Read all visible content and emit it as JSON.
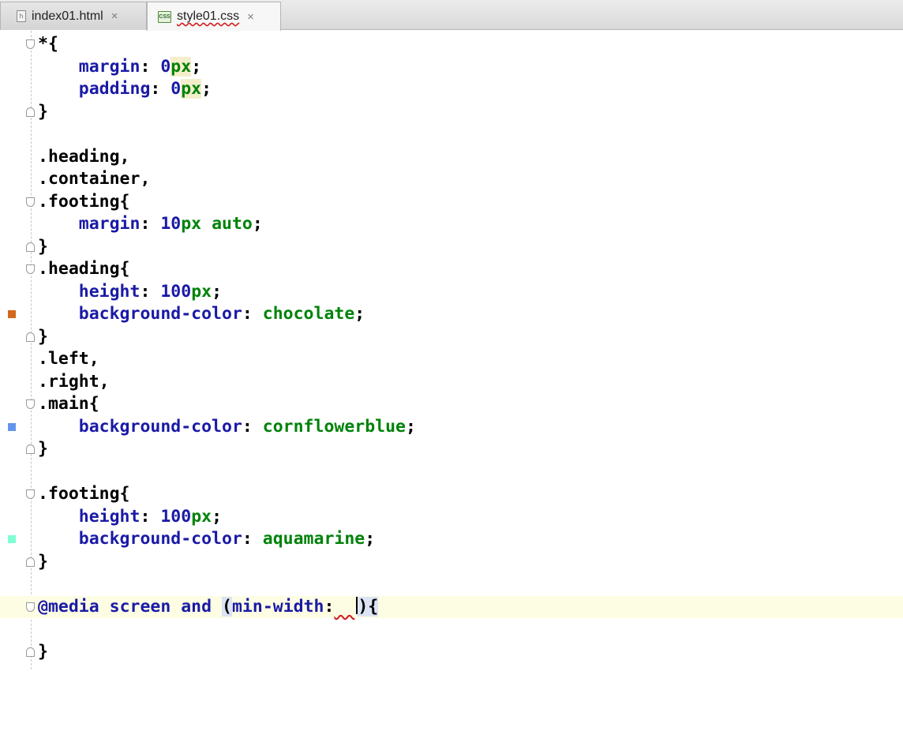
{
  "tabs": [
    {
      "icon": "html-file-icon",
      "icon_text": "h",
      "label": "index01.html",
      "close": "×"
    },
    {
      "icon": "css-file-icon",
      "icon_text": "CSS",
      "label": "style01.css",
      "close": "×"
    }
  ],
  "editor": {
    "gutter_colors": {
      "chocolate": "#d2691e",
      "cornflowerblue": "#6495ed",
      "aquamarine": "#7fffd4"
    },
    "code": {
      "l1": "*{",
      "l2": {
        "prop": "margin",
        "num": "0",
        "unit": "px"
      },
      "l3": {
        "prop": "padding",
        "num": "0",
        "unit": "px"
      },
      "l4": "}",
      "l6": ".heading,",
      "l7": ".container,",
      "l8": ".footing{",
      "l9": {
        "prop": "margin",
        "num": "10",
        "unit": "px",
        "val": "auto"
      },
      "l10": "}",
      "l11": ".heading{",
      "l12": {
        "prop": "height",
        "num": "100",
        "unit": "px"
      },
      "l13": {
        "prop": "background-color",
        "val": "chocolate"
      },
      "l14": "}",
      "l15": ".left,",
      "l16": ".right,",
      "l17": ".main{",
      "l18": {
        "prop": "background-color",
        "val": "cornflowerblue"
      },
      "l19": "}",
      "l21": ".footing{",
      "l22": {
        "prop": "height",
        "num": "100",
        "unit": "px"
      },
      "l23": {
        "prop": "background-color",
        "val": "aquamarine"
      },
      "l24": "}",
      "l26": {
        "at": "@media",
        "rest": "screen and",
        "open_paren": "(",
        "feature": "min-width",
        "colon": ":",
        "close": "){"
      },
      "l28": "}"
    }
  }
}
